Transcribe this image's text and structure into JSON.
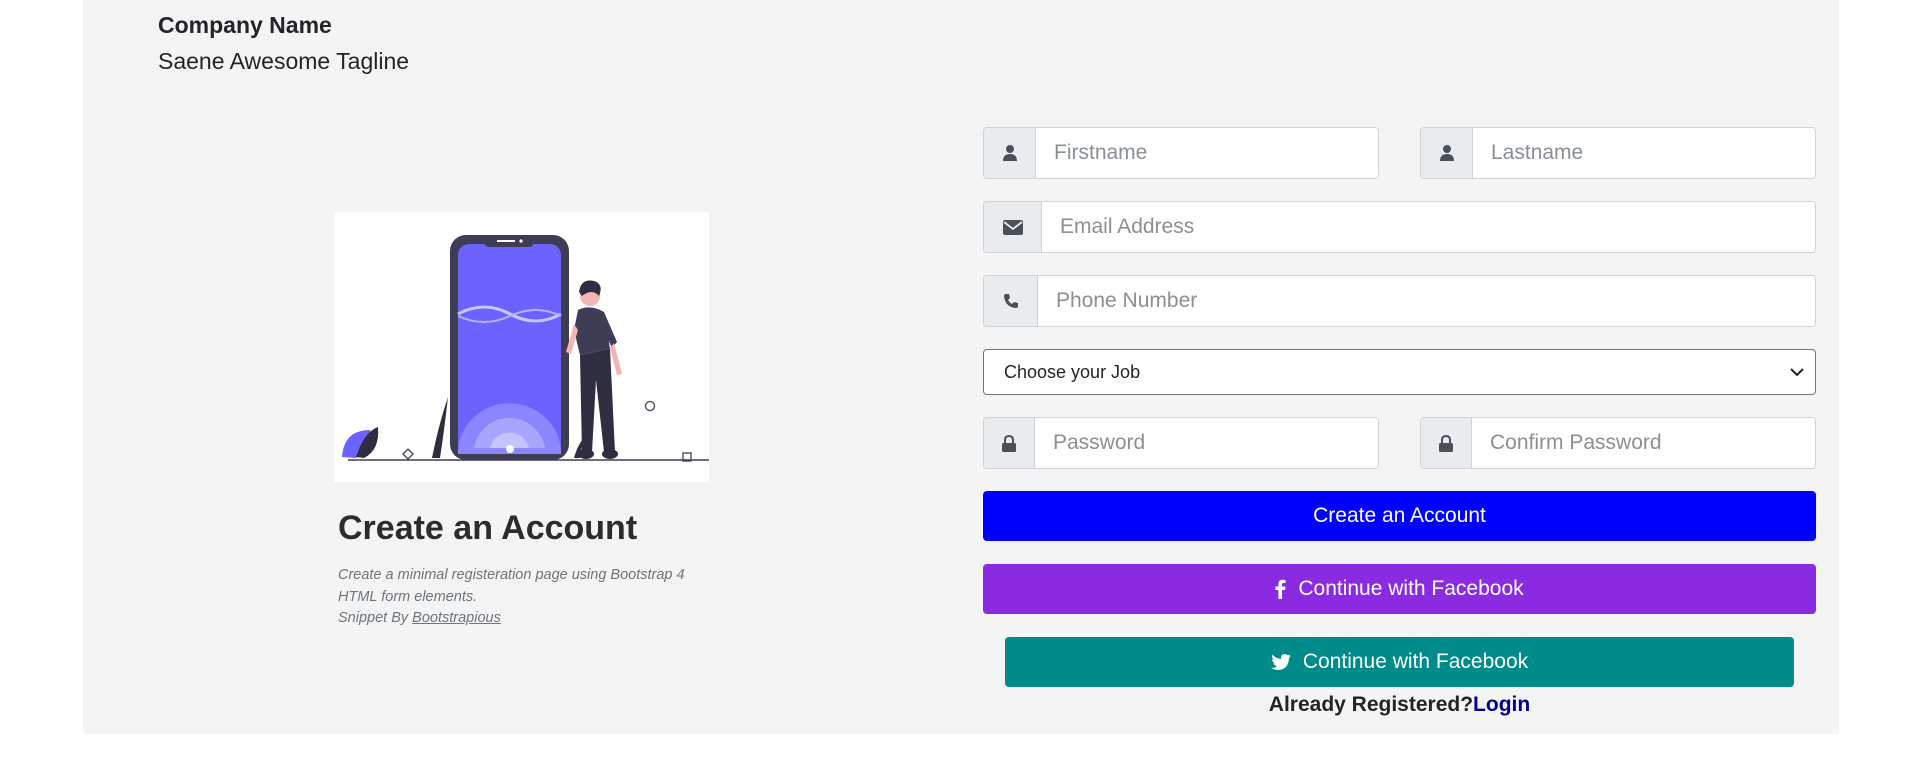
{
  "brand": {
    "name": "Company Name",
    "tagline": "Saene Awesome Tagline"
  },
  "intro": {
    "heading": "Create an Account",
    "description_line1": "Create a minimal registeration page using Bootstrap 4",
    "description_line2": "HTML form elements.",
    "snippet_prefix": "Snippet By ",
    "snippet_link": "Bootstrapious"
  },
  "form": {
    "firstname_placeholder": "Firstname",
    "lastname_placeholder": "Lastname",
    "email_placeholder": "Email Address",
    "phone_placeholder": "Phone Number",
    "job_selected": "Choose your Job",
    "password_placeholder": "Password",
    "confirm_password_placeholder": "Confirm Password",
    "create_button": "Create an Account",
    "facebook_button": "Continue with Facebook",
    "twitter_button": "Continue with Facebook",
    "already_registered": "Already Registered?",
    "login_link": "Login"
  },
  "colors": {
    "primary_button": "#0000ff",
    "facebook_button": "#8a2be2",
    "twitter_button": "#008b8b",
    "login_link": "#00008b",
    "illustration_accent": "#6c63ff"
  },
  "icons": {
    "firstname": "user-icon",
    "lastname": "user-icon",
    "email": "envelope-icon",
    "phone": "phone-icon",
    "password": "lock-icon",
    "confirm_password": "lock-icon",
    "facebook": "facebook-icon",
    "twitter": "twitter-icon",
    "select": "chevron-down-icon"
  }
}
